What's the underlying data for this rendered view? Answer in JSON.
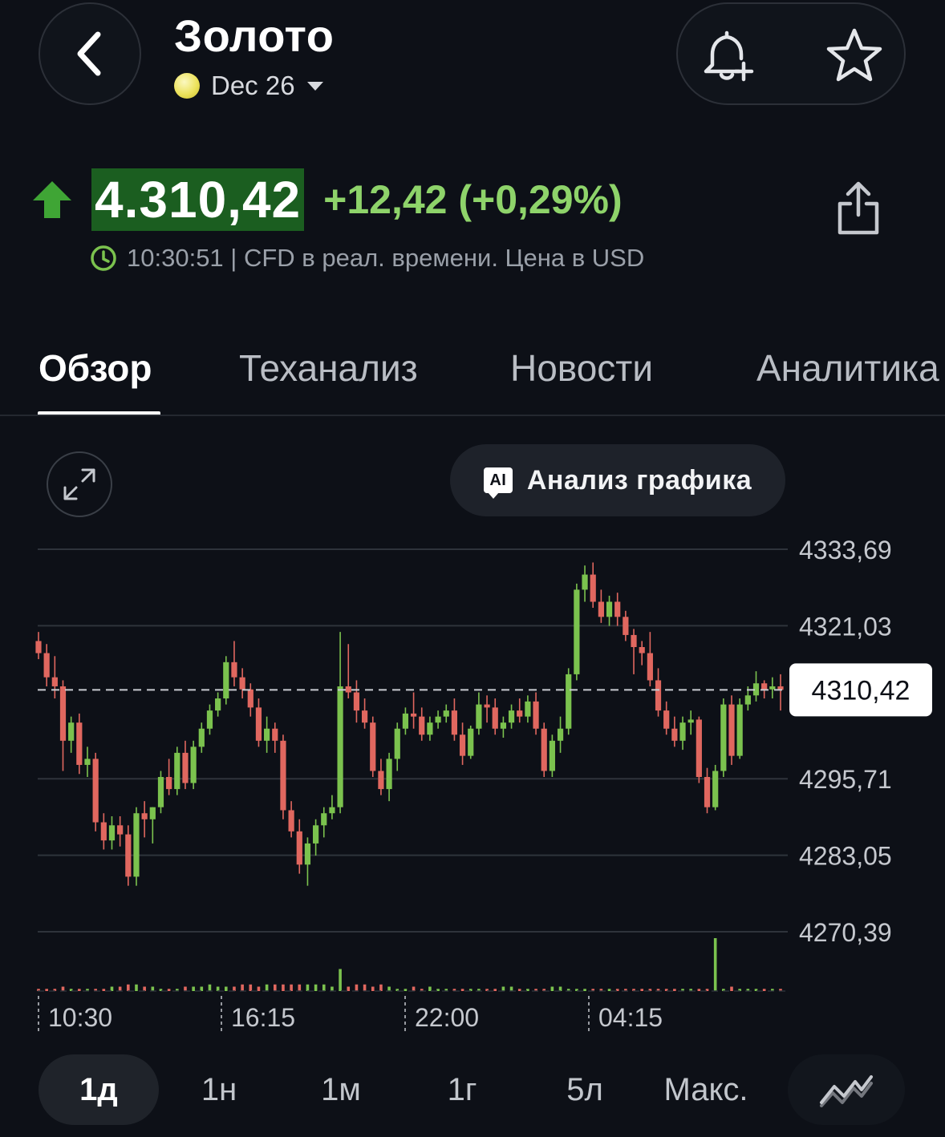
{
  "header": {
    "title": "Золото",
    "contract": "Dec 26",
    "back_icon": "chevron-left-icon",
    "alert_icon": "bell-plus-icon",
    "favorite_icon": "star-icon"
  },
  "quote": {
    "price": "4.310,42",
    "change": "+12,42 (+0,29%)",
    "direction_icon": "arrow-up-icon",
    "meta": "10:30:51 | CFD в реал. времени. Цена в USD",
    "share_icon": "share-icon",
    "colors": {
      "up": "#8ed36a",
      "price_bg": "#1b5e20"
    }
  },
  "tabs": [
    {
      "label": "Обзор",
      "active": true
    },
    {
      "label": "Теханализ",
      "active": false
    },
    {
      "label": "Новости",
      "active": false
    },
    {
      "label": "Аналитика",
      "active": false
    }
  ],
  "chart_tools": {
    "expand_icon": "expand-icon",
    "ai_label": "Анализ графика",
    "ai_badge": "AI"
  },
  "ranges": {
    "items": [
      {
        "label": "1д",
        "active": true
      },
      {
        "label": "1н",
        "active": false
      },
      {
        "label": "1м",
        "active": false
      },
      {
        "label": "1г",
        "active": false
      },
      {
        "label": "5л",
        "active": false
      },
      {
        "label": "Макс.",
        "active": false
      }
    ],
    "chart_type_icon": "line-chart-icon"
  },
  "chart_data": {
    "type": "candlestick",
    "y_ticks": [
      "4333,69",
      "4321,03",
      "4295,71",
      "4283,05",
      "4270,39"
    ],
    "y_tick_values": [
      4333.69,
      4321.03,
      4295.71,
      4283.05,
      4270.39
    ],
    "x_ticks": [
      "10:30",
      "16:15",
      "22:00",
      "04:15"
    ],
    "current_price": 4310.42,
    "current_label": "4310,42",
    "ylim": [
      4268,
      4336
    ],
    "colors": {
      "up": "#7bc24e",
      "down": "#e0675f",
      "grid": "#2e333b"
    },
    "candles": [
      [
        4318.5,
        4320.0,
        4315.5,
        4316.5
      ],
      [
        4316.5,
        4318.0,
        4311.0,
        4312.5
      ],
      [
        4312.5,
        4316.0,
        4309.0,
        4311.0
      ],
      [
        4311.0,
        4312.0,
        4297.0,
        4302.0
      ],
      [
        4302.0,
        4306.0,
        4300.0,
        4305.0
      ],
      [
        4305.0,
        4306.5,
        4296.5,
        4298.0
      ],
      [
        4298.0,
        4301.0,
        4296.0,
        4299.0
      ],
      [
        4299.0,
        4300.0,
        4287.0,
        4288.5
      ],
      [
        4288.5,
        4290.0,
        4284.0,
        4285.5
      ],
      [
        4285.5,
        4289.5,
        4284.0,
        4288.0
      ],
      [
        4288.0,
        4289.5,
        4284.5,
        4286.5
      ],
      [
        4286.5,
        4288.0,
        4278.0,
        4279.5
      ],
      [
        4279.5,
        4291.0,
        4278.0,
        4290.0
      ],
      [
        4290.0,
        4292.0,
        4286.0,
        4289.0
      ],
      [
        4289.0,
        4291.0,
        4285.0,
        4291.0
      ],
      [
        4291.0,
        4297.0,
        4290.0,
        4296.0
      ],
      [
        4296.0,
        4299.0,
        4293.0,
        4294.0
      ],
      [
        4294.0,
        4301.0,
        4293.0,
        4300.0
      ],
      [
        4300.0,
        4302.0,
        4294.0,
        4295.0
      ],
      [
        4295.0,
        4302.0,
        4294.0,
        4301.0
      ],
      [
        4301.0,
        4305.0,
        4300.0,
        4304.0
      ],
      [
        4304.0,
        4308.0,
        4303.0,
        4307.0
      ],
      [
        4307.0,
        4310.0,
        4306.0,
        4309.0
      ],
      [
        4309.0,
        4316.0,
        4308.0,
        4315.0
      ],
      [
        4315.0,
        4318.5,
        4311.0,
        4312.5
      ],
      [
        4312.5,
        4314.0,
        4309.0,
        4310.5
      ],
      [
        4310.5,
        4311.5,
        4306.0,
        4307.5
      ],
      [
        4307.5,
        4309.0,
        4301.0,
        4302.0
      ],
      [
        4302.0,
        4306.0,
        4300.0,
        4304.0
      ],
      [
        4304.0,
        4305.0,
        4300.0,
        4302.0
      ],
      [
        4302.0,
        4303.0,
        4289.0,
        4290.5
      ],
      [
        4290.5,
        4292.0,
        4286.0,
        4287.0
      ],
      [
        4287.0,
        4289.0,
        4280.0,
        4281.5
      ],
      [
        4281.5,
        4286.0,
        4278.0,
        4285.0
      ],
      [
        4285.0,
        4289.0,
        4283.0,
        4288.0
      ],
      [
        4288.0,
        4291.0,
        4286.0,
        4290.0
      ],
      [
        4290.0,
        4293.0,
        4289.0,
        4291.0
      ],
      [
        4291.0,
        4320.0,
        4290.0,
        4311.0
      ],
      [
        4311.0,
        4318.0,
        4309.0,
        4310.0
      ],
      [
        4310.0,
        4312.0,
        4305.0,
        4307.0
      ],
      [
        4307.0,
        4309.0,
        4304.0,
        4305.0
      ],
      [
        4305.0,
        4306.0,
        4296.0,
        4297.0
      ],
      [
        4297.0,
        4299.0,
        4293.0,
        4294.0
      ],
      [
        4294.0,
        4300.0,
        4292.0,
        4299.0
      ],
      [
        4299.0,
        4305.0,
        4297.0,
        4304.0
      ],
      [
        4304.0,
        4307.5,
        4303.0,
        4306.5
      ],
      [
        4306.5,
        4310.0,
        4304.0,
        4306.0
      ],
      [
        4306.0,
        4307.5,
        4302.0,
        4303.0
      ],
      [
        4303.0,
        4306.0,
        4302.0,
        4305.0
      ],
      [
        4305.0,
        4307.0,
        4304.0,
        4306.0
      ],
      [
        4306.0,
        4308.0,
        4305.0,
        4307.0
      ],
      [
        4307.0,
        4309.0,
        4302.0,
        4303.0
      ],
      [
        4303.0,
        4305.0,
        4298.0,
        4299.5
      ],
      [
        4299.5,
        4304.5,
        4299.0,
        4304.0
      ],
      [
        4304.0,
        4310.0,
        4303.0,
        4308.0
      ],
      [
        4308.0,
        4309.5,
        4305.0,
        4307.5
      ],
      [
        4307.5,
        4309.0,
        4303.0,
        4304.0
      ],
      [
        4304.0,
        4306.0,
        4302.5,
        4305.0
      ],
      [
        4305.0,
        4308.0,
        4304.0,
        4307.0
      ],
      [
        4307.0,
        4309.0,
        4305.0,
        4306.0
      ],
      [
        4306.0,
        4309.5,
        4305.0,
        4308.5
      ],
      [
        4308.5,
        4310.0,
        4303.0,
        4304.0
      ],
      [
        4304.0,
        4305.0,
        4296.0,
        4297.0
      ],
      [
        4297.0,
        4303.0,
        4296.0,
        4302.0
      ],
      [
        4302.0,
        4306.0,
        4300.0,
        4304.0
      ],
      [
        4304.0,
        4314.0,
        4303.0,
        4313.0
      ],
      [
        4313.0,
        4328.0,
        4312.0,
        4327.0
      ],
      [
        4327.0,
        4331.0,
        4325.0,
        4329.5
      ],
      [
        4329.5,
        4331.5,
        4324.0,
        4325.0
      ],
      [
        4325.0,
        4327.0,
        4321.5,
        4322.5
      ],
      [
        4322.5,
        4326.0,
        4321.0,
        4325.0
      ],
      [
        4325.0,
        4326.5,
        4321.0,
        4322.5
      ],
      [
        4322.5,
        4323.5,
        4318.5,
        4319.5
      ],
      [
        4319.5,
        4320.5,
        4313.0,
        4317.5
      ],
      [
        4317.5,
        4318.5,
        4314.5,
        4316.5
      ],
      [
        4316.5,
        4320.0,
        4311.0,
        4312.0
      ],
      [
        4312.0,
        4314.0,
        4306.0,
        4307.0
      ],
      [
        4307.0,
        4308.5,
        4303.0,
        4304.0
      ],
      [
        4304.0,
        4306.0,
        4301.0,
        4302.0
      ],
      [
        4302.0,
        4306.0,
        4300.5,
        4305.0
      ],
      [
        4305.0,
        4307.0,
        4303.0,
        4305.5
      ],
      [
        4305.5,
        4306.0,
        4295.0,
        4296.0
      ],
      [
        4296.0,
        4297.5,
        4290.0,
        4291.0
      ],
      [
        4291.0,
        4298.0,
        4290.5,
        4297.0
      ],
      [
        4297.0,
        4309.0,
        4296.0,
        4308.0
      ],
      [
        4308.0,
        4309.5,
        4298.0,
        4299.5
      ],
      [
        4299.5,
        4309.0,
        4299.0,
        4308.0
      ],
      [
        4308.0,
        4311.0,
        4307.0,
        4309.5
      ],
      [
        4309.5,
        4313.5,
        4308.5,
        4311.5
      ],
      [
        4311.5,
        4312.0,
        4309.0,
        4310.5
      ],
      [
        4310.5,
        4312.5,
        4309.0,
        4311.0
      ],
      [
        4311.0,
        4313.0,
        4307.0,
        4310.42
      ]
    ],
    "volume": [
      1,
      1,
      1,
      2,
      1,
      1,
      1,
      1,
      1,
      2,
      2,
      3,
      3,
      2,
      2,
      1,
      1,
      1,
      2,
      2,
      2,
      3,
      2,
      2,
      2,
      3,
      3,
      2,
      3,
      3,
      3,
      3,
      3,
      3,
      3,
      3,
      2,
      10,
      2,
      3,
      3,
      2,
      3,
      2,
      1,
      1,
      2,
      1,
      2,
      1,
      1,
      1,
      1,
      1,
      1,
      1,
      1,
      2,
      2,
      1,
      1,
      1,
      1,
      2,
      2,
      1,
      1,
      1,
      1,
      1,
      1,
      1,
      1,
      1,
      1,
      1,
      1,
      1,
      1,
      1,
      1,
      1,
      1,
      24,
      1,
      2,
      1,
      1,
      1,
      1,
      1,
      1
    ],
    "volume_max": 24
  }
}
